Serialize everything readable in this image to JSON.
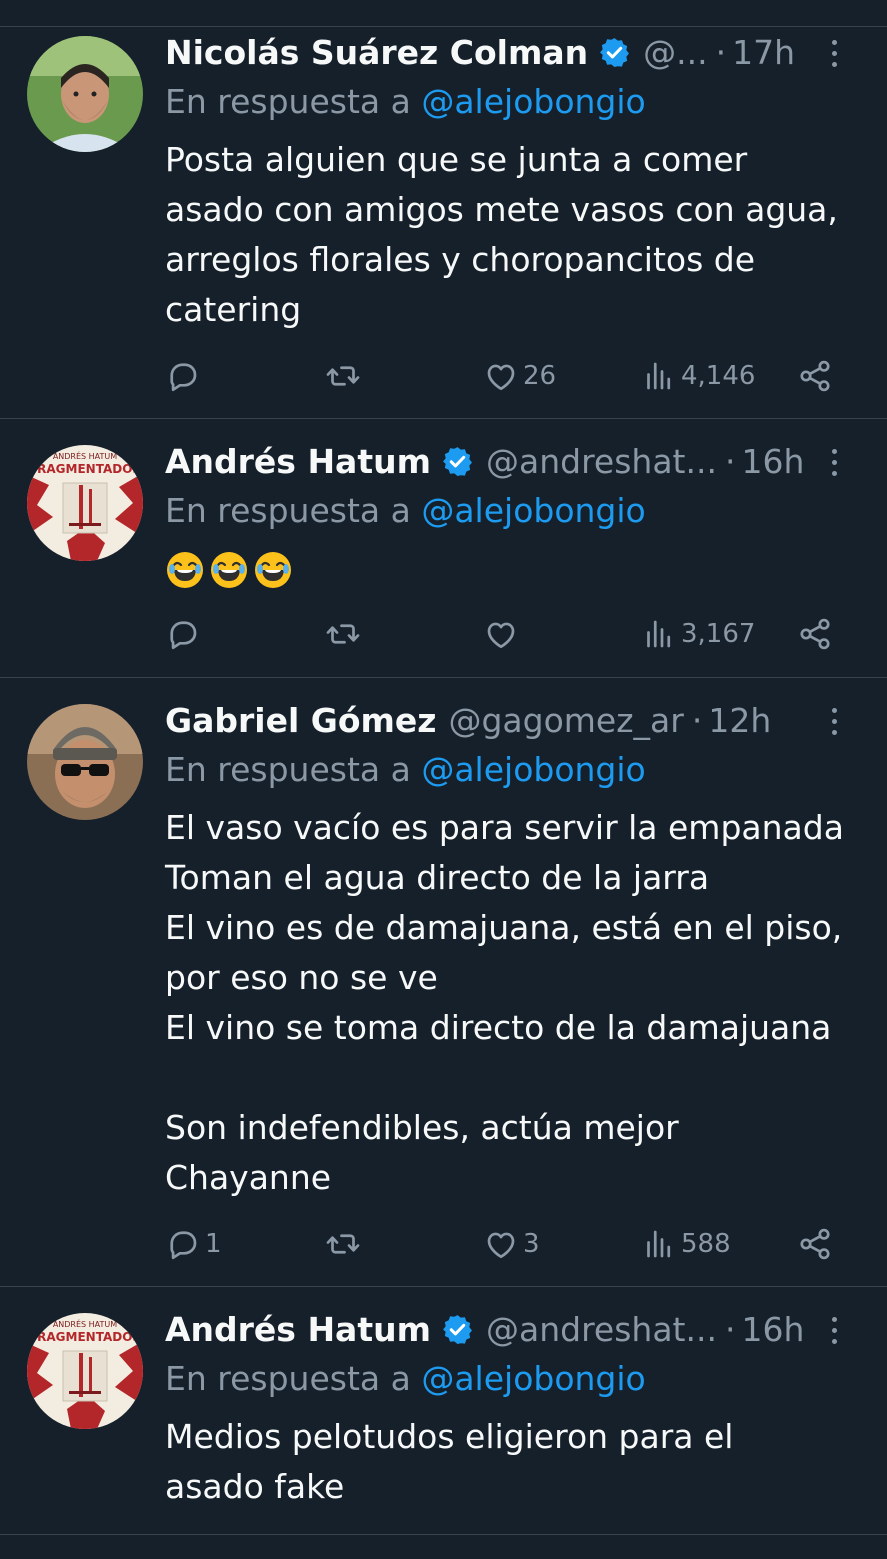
{
  "tweets": [
    {
      "name": "Nicolás Suárez Colman",
      "handle": "@...",
      "separator": "·",
      "time": "17h",
      "reply_prefix": "En respuesta a ",
      "reply_mention": "@alejobongio",
      "text": "Posta alguien que se junta a comer\nasado con amigos mete vasos con agua,\narreglos florales y choropancitos de\ncatering",
      "replies": "",
      "likes": "26",
      "views": "4,146",
      "avatar": "man-beard-photo"
    },
    {
      "name": "Andrés Hatum",
      "handle": "@andreshat...",
      "separator": "·",
      "time": "16h",
      "reply_prefix": "En respuesta a ",
      "reply_mention": "@alejobongio",
      "text": "😂😂😂",
      "replies": "",
      "likes": "",
      "views": "3,167",
      "avatar": "book-cover-fragmentados",
      "book_title": "FRAGMENTADOS",
      "book_author": "ANDRÉS HATUM"
    },
    {
      "name": "Gabriel Gómez",
      "handle": "@gagomez_ar",
      "separator": "·",
      "time": "12h",
      "reply_prefix": "En respuesta a ",
      "reply_mention": "@alejobongio",
      "text": "El vaso vacío es para servir la empanada\nToman el agua directo de la jarra\nEl vino es de damajuana, está en el piso,\npor eso no se ve\nEl vino se toma directo de la damajuana\n\nSon indefendibles, actúa mejor\nChayanne",
      "replies": "1",
      "likes": "3",
      "views": "588",
      "avatar": "man-sunglasses-beanie-photo"
    },
    {
      "name": "Andrés Hatum",
      "handle": "@andreshat...",
      "separator": "·",
      "time": "16h",
      "reply_prefix": "En respuesta a ",
      "reply_mention": "@alejobongio",
      "text": "Medios pelotudos eligieron para el\nasado fake",
      "avatar": "book-cover-fragmentados",
      "book_title": "FRAGMENTADOS",
      "book_author": "ANDRÉS HATUM"
    }
  ],
  "icons": {
    "reply": "speech-bubble-icon",
    "retweet": "retweet-arrows-icon",
    "like": "heart-icon",
    "views": "bar-chart-icon",
    "share": "share-nodes-icon",
    "verified": "verified-badge-icon",
    "more": "vertical-dots-icon"
  },
  "colors": {
    "background": "#15202b",
    "text": "#f7f9f9",
    "muted": "#8b98a5",
    "accent": "#1d9bf0",
    "divider": "#38444d"
  }
}
